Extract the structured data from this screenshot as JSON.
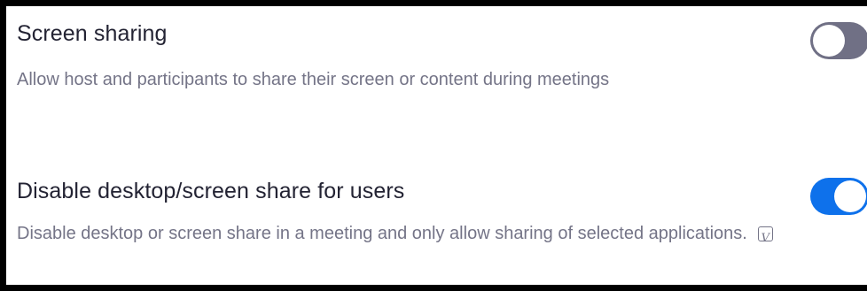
{
  "settings": [
    {
      "title": "Screen sharing",
      "description": "Allow host and participants to share their screen or content during meetings",
      "toggle_state": "off",
      "toggle_color": "#707085"
    },
    {
      "title": "Disable desktop/screen share for users",
      "description": "Disable desktop or screen share in a meeting and only allow sharing of selected applications.",
      "toggle_state": "on",
      "toggle_color": "#0e71eb",
      "badge_icon": "version-v-icon",
      "badge_glyph": "V"
    }
  ],
  "colors": {
    "frame": "#000000",
    "title_text": "#232333",
    "description_text": "#747487",
    "toggle_on": "#0e71eb",
    "toggle_off": "#707085"
  }
}
